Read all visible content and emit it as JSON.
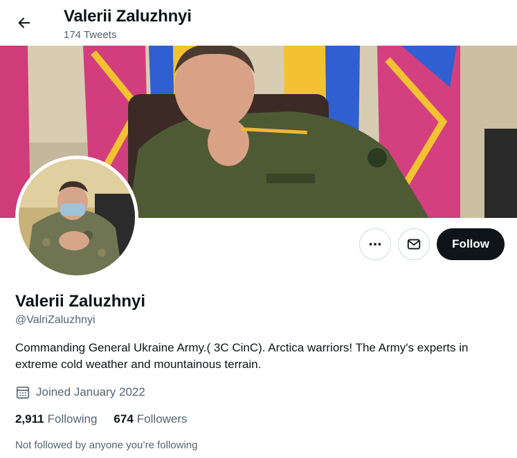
{
  "header": {
    "name": "Valerii Zaluzhnyi",
    "tweet_count": "174 Tweets",
    "back_icon": "arrow-left-icon"
  },
  "banner": {
    "description_colors": {
      "flag_blue": "#2f5fd0",
      "flag_yellow": "#f2c230",
      "flag_magenta": "#d03b7a",
      "uniform": "#4e5a34"
    }
  },
  "actions": {
    "more_icon": "more-horizontal-icon",
    "message_icon": "envelope-icon",
    "follow_label": "Follow"
  },
  "profile": {
    "name": "Valerii Zaluzhnyi",
    "handle": "@ValriZaluzhnyi",
    "bio": "Commanding General Ukraine Army.( 3C CinC). Arctica warriors! The Army's experts in extreme cold weather and mountainous terrain.",
    "joined": "Joined January 2022",
    "calendar_icon": "calendar-icon",
    "following_count": "2,911",
    "following_label": "Following",
    "followers_count": "674",
    "followers_label": "Followers",
    "not_followed_note": "Not followed by anyone you’re following"
  },
  "colors": {
    "text_primary": "#0f1419",
    "text_secondary": "#536471",
    "follow_button": "#0f1419",
    "border": "#cfd9de"
  }
}
